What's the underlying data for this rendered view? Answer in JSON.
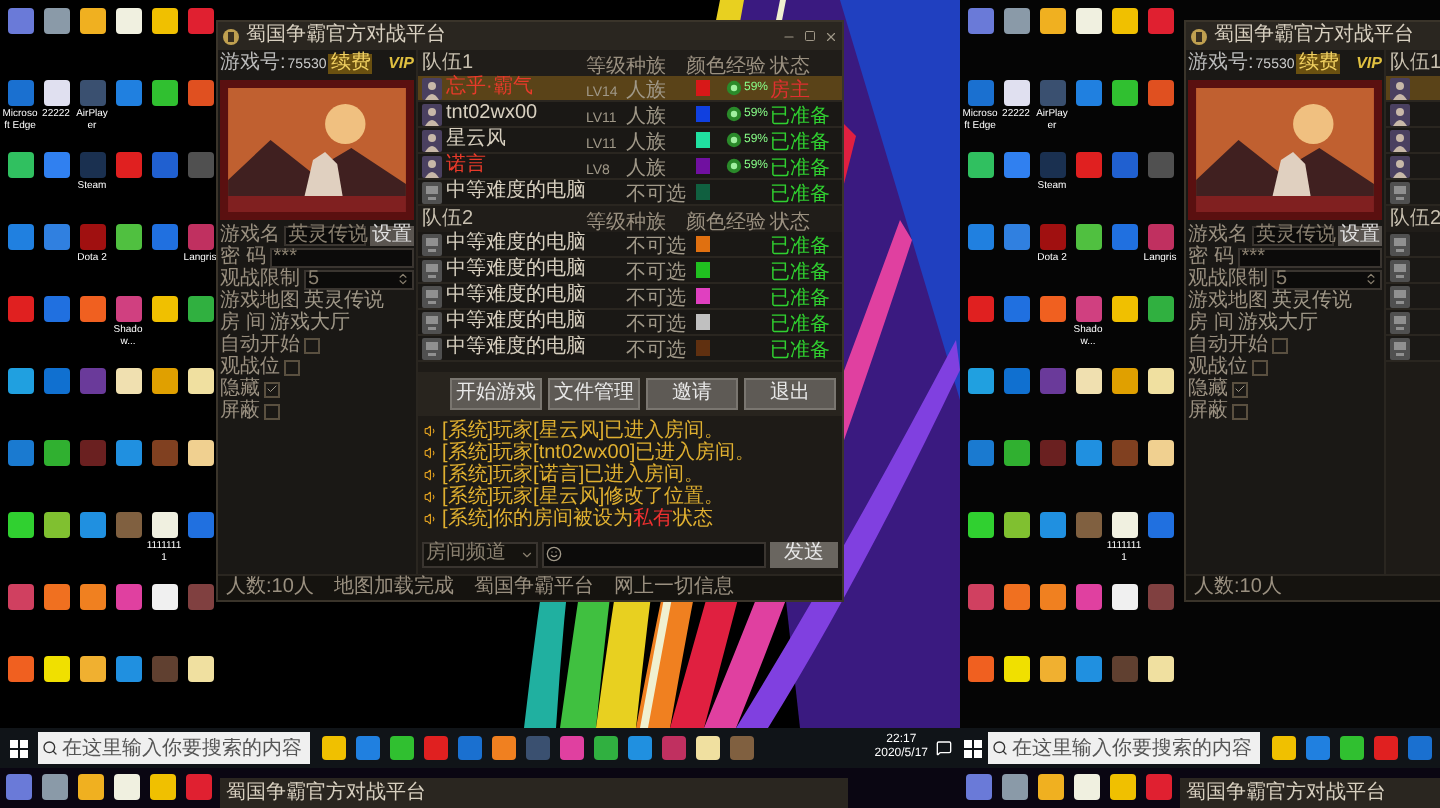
{
  "left_screen": {
    "desktop_icons": [
      {
        "color": "#6a7ad8"
      },
      {
        "color": "#8a9aa8"
      },
      {
        "color": "#f0b020"
      },
      {
        "color": "#f0f0e0"
      },
      {
        "color": "#f0c000"
      },
      {
        "color": "#e02030"
      },
      {
        "color": "#1a70d0",
        "label": "Microsoft Edge"
      },
      {
        "color": "#e0e0f0",
        "label": "22222"
      },
      {
        "color": "#3a5070",
        "label": "AirPlayer"
      },
      {
        "color": "#2080e0"
      },
      {
        "color": "#30c030"
      },
      {
        "color": "#e05020"
      },
      {
        "color": "#30c060"
      },
      {
        "color": "#3080f0"
      },
      {
        "color": "#1a3050",
        "label": "Steam"
      },
      {
        "color": "#e02020"
      },
      {
        "color": "#2060d0"
      },
      {
        "color": "#505050"
      },
      {
        "color": "#2080e0"
      },
      {
        "color": "#3080e0"
      },
      {
        "color": "#a01010",
        "label": "Dota 2"
      },
      {
        "color": "#50c040"
      },
      {
        "color": "#2070e0"
      },
      {
        "color": "#c03060",
        "label": "Langris"
      },
      {
        "color": "#e02020"
      },
      {
        "color": "#2070e0"
      },
      {
        "color": "#f06020"
      },
      {
        "color": "#d04080",
        "label": "Shadow..."
      },
      {
        "color": "#f0c000"
      },
      {
        "color": "#30b040"
      },
      {
        "color": "#20a0e0"
      },
      {
        "color": "#1070d0"
      },
      {
        "color": "#6a3a9a"
      },
      {
        "color": "#f0e0b0"
      },
      {
        "color": "#e0a000"
      },
      {
        "color": "#f0e0a0"
      },
      {
        "color": "#1a7ad0"
      },
      {
        "color": "#30b030"
      },
      {
        "color": "#6a2020"
      },
      {
        "color": "#2090e0"
      },
      {
        "color": "#804020"
      },
      {
        "color": "#f0d090"
      },
      {
        "color": "#30d030"
      },
      {
        "color": "#80c030"
      },
      {
        "color": "#2090e0"
      },
      {
        "color": "#806040"
      },
      {
        "color": "#f0f0e0",
        "label": "11111111"
      },
      {
        "color": "#2070e0"
      },
      {
        "color": "#d04060"
      },
      {
        "color": "#f07020"
      },
      {
        "color": "#f08020"
      },
      {
        "color": "#e040a0"
      },
      {
        "color": "#f0f0f0"
      },
      {
        "color": "#804040"
      },
      {
        "color": "#f06020"
      },
      {
        "color": "#f0e000"
      },
      {
        "color": "#f0b030"
      },
      {
        "color": "#2090e0"
      },
      {
        "color": "#604030"
      },
      {
        "color": "#f0e0a0"
      }
    ],
    "window": {
      "title": "蜀国争霸官方对战平台",
      "controls": true,
      "account": {
        "label": "游戏号:",
        "number": "75530",
        "renew": "续费",
        "vip": "VIP"
      },
      "form": [
        {
          "kind": "field",
          "label": "游戏名",
          "value": "英灵传说",
          "button": "设置"
        },
        {
          "kind": "field",
          "label": "密 码",
          "value": "***"
        },
        {
          "kind": "spinner",
          "label": "观战限制",
          "value": "5"
        },
        {
          "kind": "text",
          "label": "游戏地图",
          "value": "英灵传说"
        },
        {
          "kind": "text",
          "label": "房 间",
          "value": "游戏大厅"
        },
        {
          "kind": "checkbox",
          "label": "自动开始",
          "checked": false
        },
        {
          "kind": "checkbox",
          "label": "观战位",
          "checked": false
        },
        {
          "kind": "checkbox",
          "label": "隐藏",
          "checked": true
        },
        {
          "kind": "checkbox",
          "label": "屏蔽",
          "checked": false
        }
      ],
      "teams": [
        {
          "name": "队伍1",
          "columns": [
            "等级",
            "种族",
            "颜色",
            "经验",
            "状态"
          ],
          "rows": [
            {
              "kind": "player",
              "name": "忘乎·霸气",
              "level": "LV14",
              "race": "人族",
              "color": "#d81818",
              "exp": "59%",
              "status": "房主",
              "ready": false,
              "selected": true,
              "highlight_name": true
            },
            {
              "kind": "player",
              "name": "tnt02wx00",
              "level": "LV11",
              "race": "人族",
              "color": "#1040e0",
              "exp": "59%",
              "status": "已准备",
              "ready": true,
              "selected": false,
              "highlight_name": false
            },
            {
              "kind": "player",
              "name": "星云风",
              "level": "LV11",
              "race": "人族",
              "color": "#20e0a0",
              "exp": "59%",
              "status": "已准备",
              "ready": true,
              "selected": false,
              "highlight_name": false
            },
            {
              "kind": "player",
              "name": "诺言",
              "level": "LV8",
              "race": "人族",
              "color": "#7010a0",
              "exp": "59%",
              "status": "已准备",
              "ready": true,
              "selected": false,
              "highlight_name": true
            },
            {
              "kind": "computer",
              "name": "中等难度的电脑",
              "race": "不可选",
              "color": "#106040",
              "status": "已准备",
              "ready": true,
              "selected": false,
              "highlight_name": false
            }
          ]
        },
        {
          "name": "队伍2",
          "columns": [
            "等级",
            "种族",
            "颜色",
            "经验",
            "状态"
          ],
          "rows": [
            {
              "kind": "computer",
              "name": "中等难度的电脑",
              "race": "不可选",
              "color": "#e07010",
              "status": "已准备",
              "ready": true,
              "selected": false,
              "highlight_name": false
            },
            {
              "kind": "computer",
              "name": "中等难度的电脑",
              "race": "不可选",
              "color": "#20c020",
              "status": "已准备",
              "ready": true,
              "selected": false,
              "highlight_name": false
            },
            {
              "kind": "computer",
              "name": "中等难度的电脑",
              "race": "不可选",
              "color": "#e040c0",
              "status": "已准备",
              "ready": true,
              "selected": false,
              "highlight_name": false
            },
            {
              "kind": "computer",
              "name": "中等难度的电脑",
              "race": "不可选",
              "color": "#c0c0c0",
              "status": "已准备",
              "ready": true,
              "selected": false,
              "highlight_name": false
            },
            {
              "kind": "computer",
              "name": "中等难度的电脑",
              "race": "不可选",
              "color": "#603010",
              "status": "已准备",
              "ready": true,
              "selected": false,
              "highlight_name": false
            }
          ]
        }
      ],
      "buttons": [
        "开始游戏",
        "文件管理",
        "邀请",
        "退出"
      ],
      "chat": [
        {
          "parts": [
            {
              "text": "[系统]玩家[星云风]已进入房间。",
              "red": false
            }
          ]
        },
        {
          "parts": [
            {
              "text": "[系统]玩家[tnt02wx00]已进入房间。",
              "red": false
            }
          ]
        },
        {
          "parts": [
            {
              "text": "[系统]玩家[诺言]已进入房间。",
              "red": false
            }
          ]
        },
        {
          "parts": [
            {
              "text": "[系统]玩家[星云风]修改了位置。",
              "red": false
            }
          ]
        },
        {
          "parts": [
            {
              "text": "[系统]你的房间被设为",
              "red": false
            },
            {
              "text": "私有",
              "red": true
            },
            {
              "text": "状态",
              "red": false
            }
          ]
        }
      ],
      "chat_input": {
        "channel": "房间频道",
        "send": "发送"
      },
      "status": [
        "人数:10人",
        "地图加载完成",
        "蜀国争霸平台",
        "网上一切信息"
      ]
    },
    "taskbar": {
      "search_placeholder": "在这里输入你要搜索的内容",
      "apps": [
        {
          "color": "#f0c000"
        },
        {
          "color": "#2080e0"
        },
        {
          "color": "#30c030"
        },
        {
          "color": "#e02020"
        },
        {
          "color": "#1a70d0"
        },
        {
          "color": "#f08020"
        },
        {
          "color": "#3a5070"
        },
        {
          "color": "#e040a0"
        },
        {
          "color": "#30b040"
        },
        {
          "color": "#2090e0"
        },
        {
          "color": "#c03060"
        },
        {
          "color": "#f0e0a0"
        },
        {
          "color": "#806040"
        }
      ],
      "time": "22:17",
      "date": "2020/5/17"
    }
  },
  "right_screen": {
    "desktop_icons": [
      {
        "color": "#6a7ad8"
      },
      {
        "color": "#8a9aa8"
      },
      {
        "color": "#f0b020"
      },
      {
        "color": "#f0f0e0"
      },
      {
        "color": "#f0c000"
      },
      {
        "color": "#e02030"
      },
      {
        "color": "#1a70d0",
        "label": "Microsoft Edge"
      },
      {
        "color": "#e0e0f0",
        "label": "22222"
      },
      {
        "color": "#3a5070",
        "label": "AirPlayer"
      },
      {
        "color": "#2080e0"
      },
      {
        "color": "#30c030"
      },
      {
        "color": "#e05020"
      },
      {
        "color": "#30c060"
      },
      {
        "color": "#3080f0"
      },
      {
        "color": "#1a3050",
        "label": "Steam"
      },
      {
        "color": "#e02020"
      },
      {
        "color": "#2060d0"
      },
      {
        "color": "#505050"
      },
      {
        "color": "#2080e0"
      },
      {
        "color": "#3080e0"
      },
      {
        "color": "#a01010",
        "label": "Dota 2"
      },
      {
        "color": "#50c040"
      },
      {
        "color": "#2070e0"
      },
      {
        "color": "#c03060",
        "label": "Langris"
      },
      {
        "color": "#e02020"
      },
      {
        "color": "#2070e0"
      },
      {
        "color": "#f06020"
      },
      {
        "color": "#d04080",
        "label": "Shadow..."
      },
      {
        "color": "#f0c000"
      },
      {
        "color": "#30b040"
      },
      {
        "color": "#20a0e0"
      },
      {
        "color": "#1070d0"
      },
      {
        "color": "#6a3a9a"
      },
      {
        "color": "#f0e0b0"
      },
      {
        "color": "#e0a000"
      },
      {
        "color": "#f0e0a0"
      },
      {
        "color": "#1a7ad0"
      },
      {
        "color": "#30b030"
      },
      {
        "color": "#6a2020"
      },
      {
        "color": "#2090e0"
      },
      {
        "color": "#804020"
      },
      {
        "color": "#f0d090"
      },
      {
        "color": "#30d030"
      },
      {
        "color": "#80c030"
      },
      {
        "color": "#2090e0"
      },
      {
        "color": "#806040"
      },
      {
        "color": "#f0f0e0",
        "label": "11111111"
      },
      {
        "color": "#2070e0"
      },
      {
        "color": "#d04060"
      },
      {
        "color": "#f07020"
      },
      {
        "color": "#f08020"
      },
      {
        "color": "#e040a0"
      },
      {
        "color": "#f0f0f0"
      },
      {
        "color": "#804040"
      },
      {
        "color": "#f06020"
      },
      {
        "color": "#f0e000"
      },
      {
        "color": "#f0b030"
      },
      {
        "color": "#2090e0"
      },
      {
        "color": "#604030"
      },
      {
        "color": "#f0e0a0"
      }
    ],
    "window": {
      "title": "蜀国争霸官方对战平台",
      "account": {
        "label": "游戏号:",
        "number": "75530",
        "renew": "续费",
        "vip": "VIP"
      },
      "form": [
        {
          "kind": "field",
          "label": "游戏名",
          "value": "英灵传说",
          "button": "设置"
        },
        {
          "kind": "field",
          "label": "密 码",
          "value": "***"
        },
        {
          "kind": "spinner",
          "label": "观战限制",
          "value": "5"
        },
        {
          "kind": "text",
          "label": "游戏地图",
          "value": "英灵传说"
        },
        {
          "kind": "text",
          "label": "房 间",
          "value": "游戏大厅"
        },
        {
          "kind": "checkbox",
          "label": "自动开始",
          "checked": false
        },
        {
          "kind": "checkbox",
          "label": "观战位",
          "checked": false
        },
        {
          "kind": "checkbox",
          "label": "隐藏",
          "checked": true
        },
        {
          "kind": "checkbox",
          "label": "屏蔽",
          "checked": false
        }
      ],
      "teams": [
        {
          "name": "队伍1",
          "rows": [
            {
              "kind": "player",
              "selected": true
            },
            {
              "kind": "player",
              "selected": false
            },
            {
              "kind": "player",
              "selected": false
            },
            {
              "kind": "player",
              "selected": false
            },
            {
              "kind": "computer",
              "selected": false
            }
          ]
        },
        {
          "name": "队伍2",
          "rows": [
            {
              "kind": "computer",
              "selected": false
            },
            {
              "kind": "computer",
              "selected": false
            },
            {
              "kind": "computer",
              "selected": false
            },
            {
              "kind": "computer",
              "selected": false
            },
            {
              "kind": "computer",
              "selected": false
            }
          ]
        }
      ],
      "status": [
        "人数:10人"
      ]
    },
    "taskbar": {
      "search_placeholder": "在这里输入你要搜索的内容",
      "apps": [
        {
          "color": "#f0c000"
        },
        {
          "color": "#2080e0"
        },
        {
          "color": "#30c030"
        },
        {
          "color": "#e02020"
        },
        {
          "color": "#1a70d0"
        }
      ]
    }
  },
  "bottom_strip": {
    "left": {
      "icons": [
        {
          "color": "#6a7ad8"
        },
        {
          "color": "#8a9aa8"
        },
        {
          "color": "#f0b020"
        },
        {
          "color": "#f0f0e0"
        },
        {
          "color": "#f0c000"
        },
        {
          "color": "#e02030"
        }
      ],
      "window_title": "蜀国争霸官方对战平台"
    },
    "right": {
      "icons": [
        {
          "color": "#6a7ad8"
        },
        {
          "color": "#8a9aa8"
        },
        {
          "color": "#f0b020"
        },
        {
          "color": "#f0f0e0"
        },
        {
          "color": "#f0c000"
        },
        {
          "color": "#e02030"
        }
      ],
      "window_title": "蜀国争霸官方对战平台"
    }
  }
}
